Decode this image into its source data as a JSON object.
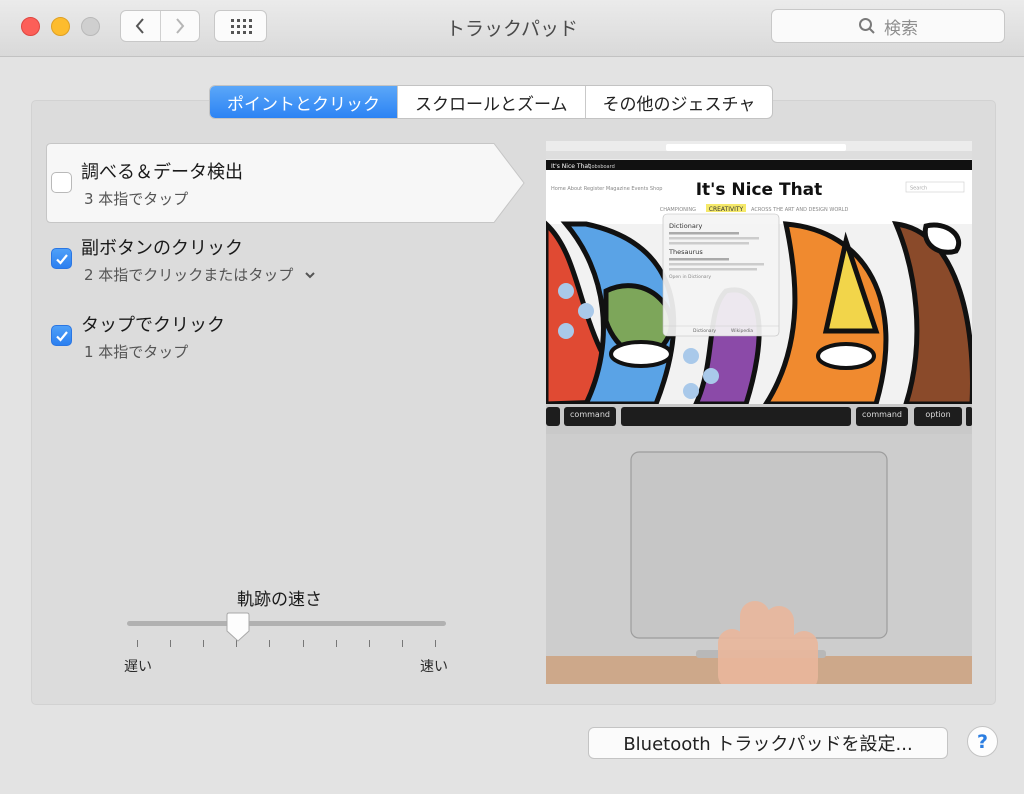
{
  "window": {
    "title": "トラックパッド"
  },
  "search": {
    "placeholder": "検索"
  },
  "tabs": [
    {
      "label": "ポイントとクリック",
      "active": true
    },
    {
      "label": "スクロールとズーム",
      "active": false
    },
    {
      "label": "その他のジェスチャ",
      "active": false
    }
  ],
  "options": [
    {
      "title": "調べる＆データ検出",
      "subtitle": "3 本指でタップ",
      "checked": false
    },
    {
      "title": "副ボタンのクリック",
      "subtitle": "2 本指でクリックまたはタップ",
      "checked": true
    },
    {
      "title": "タップでクリック",
      "subtitle": "1 本指でタップ",
      "checked": true
    }
  ],
  "tracking": {
    "title": "軌跡の速さ",
    "slow_label": "遅い",
    "fast_label": "速い",
    "value_fraction": 0.34,
    "tick_count": 10
  },
  "preview": {
    "site_title": "It's Nice That",
    "nav_brand": "It's Nice That",
    "nav_link": "Jobsboard",
    "menu_links": "Home  About  Register  Magazine  Events  Shop",
    "search_box": "Search",
    "tagline_before": "CHAMPIONING",
    "tagline_highlight": "CREATIVITY",
    "tagline_after": "ACROSS THE ART AND DESIGN WORLD",
    "popup_heading1": "Dictionary",
    "popup_heading2": "Thesaurus",
    "popup_link": "Open in Dictionary",
    "popup_btn1": "Dictionary",
    "popup_btn2": "Wikipedia",
    "key_left": "command",
    "key_right1": "command",
    "key_right2": "option"
  },
  "bluetooth_button": {
    "label": "Bluetooth トラックパッドを設定..."
  },
  "help_button": {
    "label": "?"
  },
  "colors": {
    "accent": "#2c83f4",
    "close": "#fc5f58",
    "minimize": "#fdbc2e",
    "zoom": "#cfcfcf"
  }
}
